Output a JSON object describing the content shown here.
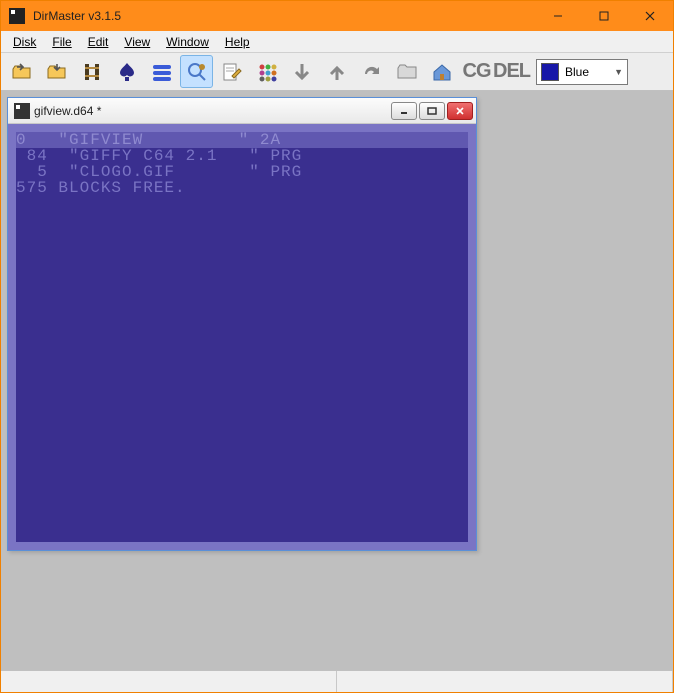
{
  "app": {
    "title": "DirMaster v3.1.5"
  },
  "menu": {
    "disk": {
      "label": "Disk",
      "hotkey_index": 0
    },
    "file": {
      "label": "File",
      "hotkey_index": 0
    },
    "edit": {
      "label": "Edit",
      "hotkey_index": 0
    },
    "view": {
      "label": "View",
      "hotkey_index": 0
    },
    "window": {
      "label": "Window",
      "hotkey_index": 0
    },
    "help": {
      "label": "Help",
      "hotkey_index": 0
    }
  },
  "toolbar": {
    "color_label": "Blue",
    "color_hex": "#1818a8",
    "btn_cg": "CG",
    "btn_del": "DEL"
  },
  "child": {
    "title": "gifview.d64 *"
  },
  "disk": {
    "header": {
      "track_blocks": "0",
      "name": "GIFVIEW",
      "id": "2A"
    },
    "entries": [
      {
        "blocks": "84",
        "name": "GIFFY C64 2.1",
        "type": "PRG"
      },
      {
        "blocks": "5",
        "name": "CLOGO.GIF",
        "type": "PRG"
      }
    ],
    "blocks_free": "575",
    "blocks_free_label": "BLOCKS FREE."
  }
}
